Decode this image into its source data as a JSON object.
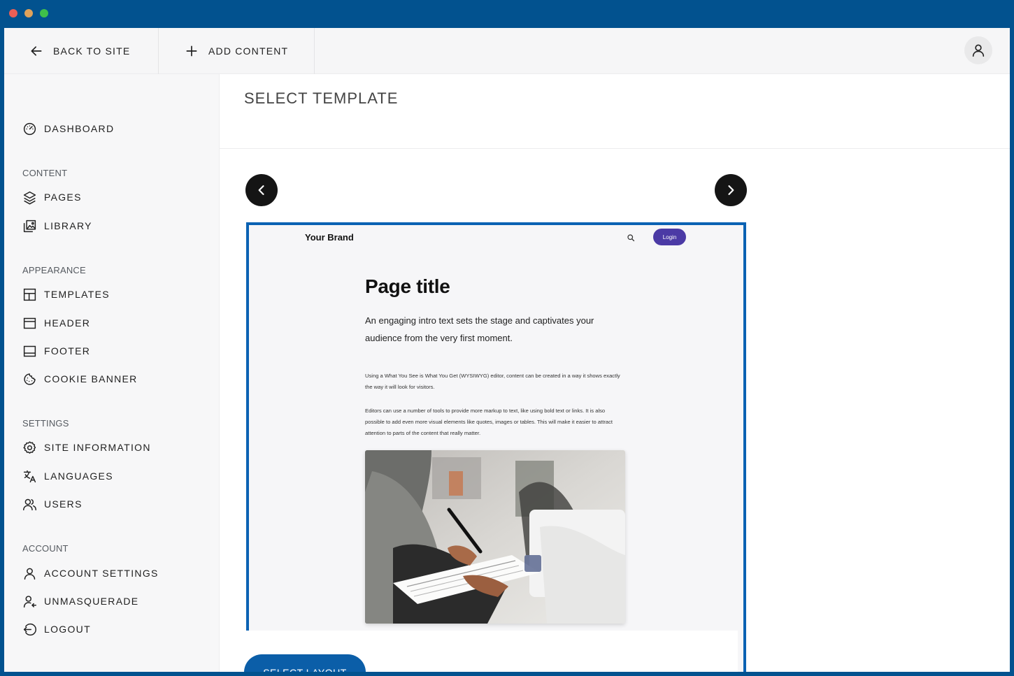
{
  "topbar": {
    "back_label": "BACK TO SITE",
    "add_label": "ADD CONTENT",
    "back_icon": "arrow-left-icon",
    "add_icon": "plus-icon",
    "avatar_icon": "user-icon"
  },
  "sidebar": {
    "dashboard": "DASHBOARD",
    "sections": {
      "content": "CONTENT",
      "appearance": "APPEARANCE",
      "settings": "SETTINGS",
      "account": "ACCOUNT"
    },
    "items": {
      "pages": "PAGES",
      "library": "LIBRARY",
      "templates": "TEMPLATES",
      "header": "HEADER",
      "footer": "FOOTER",
      "cookie_banner": "COOKIE BANNER",
      "site_information": "SITE INFORMATION",
      "languages": "LANGUAGES",
      "users": "USERS",
      "account_settings": "ACCOUNT SETTINGS",
      "unmasquerade": "UNMASQUERADE",
      "logout": "LOGOUT"
    }
  },
  "main": {
    "title": "SELECT TEMPLATE",
    "select_button": "SELECT LAYOUT",
    "prev_icon": "chevron-left-icon",
    "next_icon": "chevron-right-icon"
  },
  "template_preview": {
    "brand": "Your Brand",
    "login": "Login",
    "title": "Page title",
    "intro": "An engaging intro text sets the stage and captivates your audience from the very first moment.",
    "paragraph1": "Using a What You See is What You Get (WYSIWYG) editor, content can be created in a way it shows exactly the way it will look for visitors.",
    "paragraph2": "Editors can use a number of tools to provide more markup to text, like using bold text or links. It is also possible to add even more visual elements like quotes, images or tables. This will make it easier to attract attention to parts of the content that really matter."
  },
  "colors": {
    "frame_blue": "#02528f",
    "accent": "#0b5ea8",
    "login_purple": "#4b3aa5"
  }
}
